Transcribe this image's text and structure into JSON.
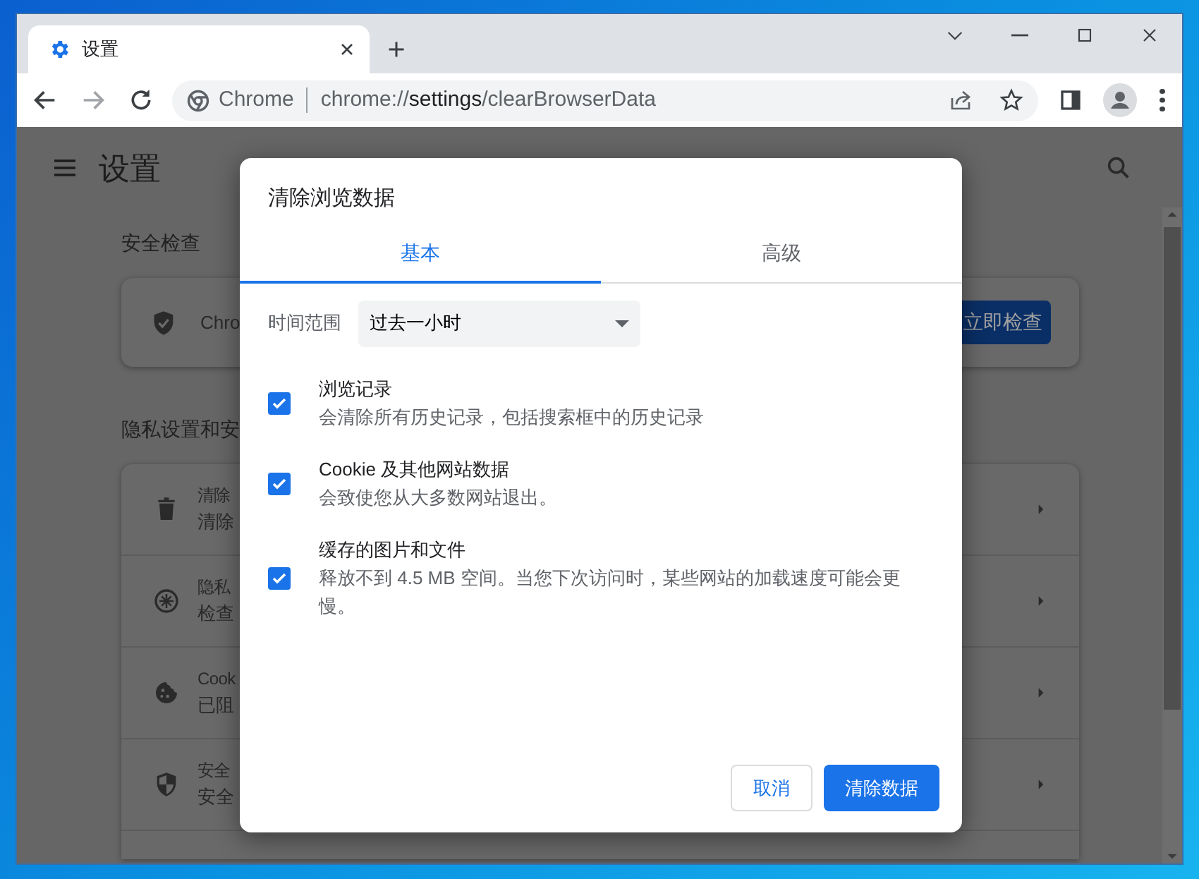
{
  "browser": {
    "tabs": [
      {
        "title": "设置",
        "selected": true
      }
    ],
    "omnibox": {
      "site_label": "Chrome",
      "url_scheme": "chrome://",
      "url_host": "settings",
      "url_path": "/clearBrowserData"
    }
  },
  "page": {
    "title": "设置",
    "safety_check": {
      "heading": "安全检查",
      "text": "Chro",
      "button": "立即检查"
    },
    "privacy": {
      "heading": "隐私设置和安",
      "rows": [
        {
          "title": "清除",
          "subtitle": "清除"
        },
        {
          "title": "隐私",
          "subtitle": "检查"
        },
        {
          "title": "Cook",
          "subtitle": "已阻"
        },
        {
          "title": "安全",
          "subtitle": "安全"
        }
      ]
    }
  },
  "dialog": {
    "title": "清除浏览数据",
    "tabs": [
      {
        "label": "基本",
        "selected": true
      },
      {
        "label": "高级",
        "selected": false
      }
    ],
    "time_range": {
      "label": "时间范围",
      "value": "过去一小时"
    },
    "options": [
      {
        "title": "浏览记录",
        "description": "会清除所有历史记录，包括搜索框中的历史记录",
        "checked": true
      },
      {
        "title": "Cookie 及其他网站数据",
        "description": "会致使您从大多数网站退出。",
        "checked": true
      },
      {
        "title": "缓存的图片和文件",
        "description": "释放不到 4.5 MB 空间。当您下次访问时，某些网站的加载速度可能会更慢。",
        "checked": true
      }
    ],
    "buttons": [
      {
        "label": "取消",
        "kind": "secondary"
      },
      {
        "label": "清除数据",
        "kind": "primary"
      }
    ]
  }
}
